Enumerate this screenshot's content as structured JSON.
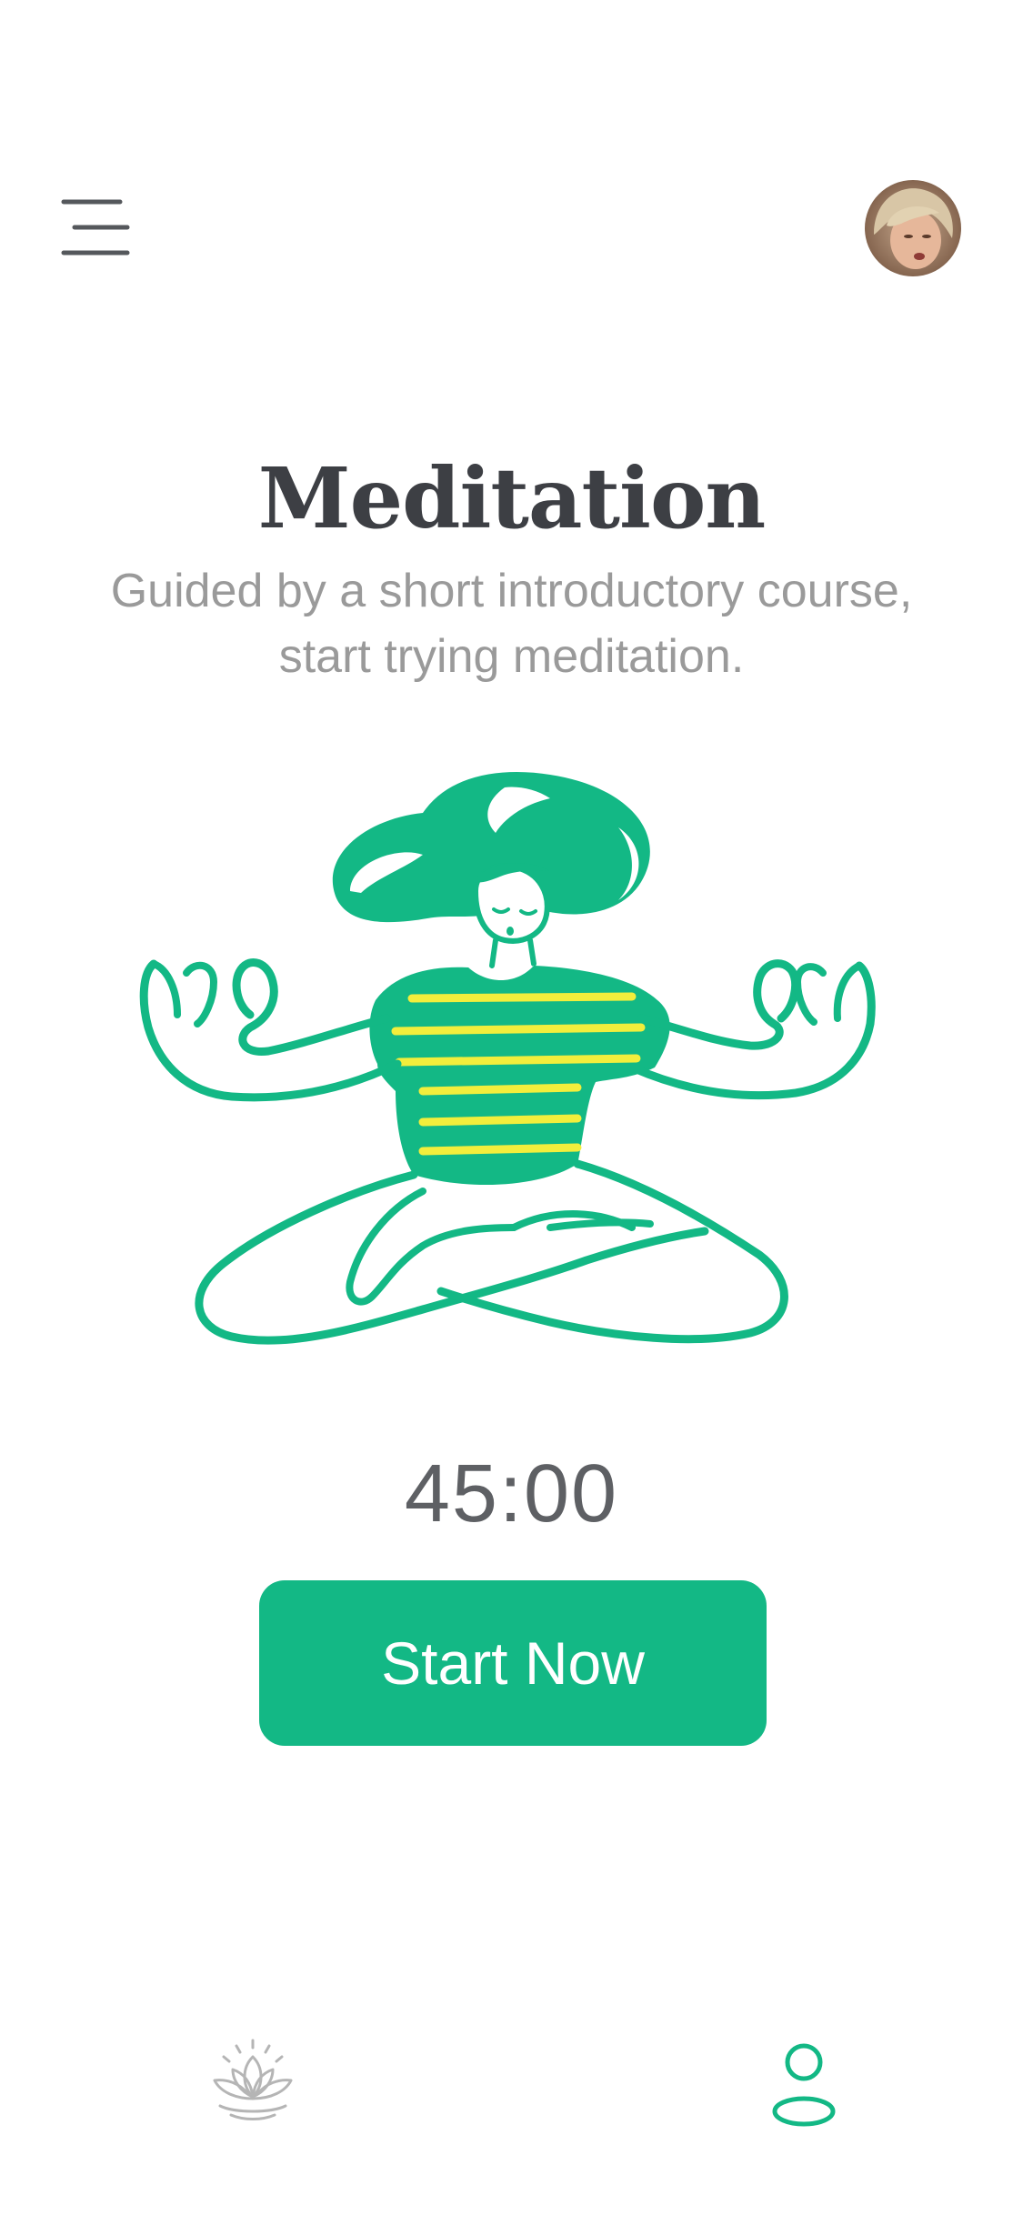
{
  "header": {
    "menu_icon": "hamburger-menu-icon",
    "avatar_icon": "user-avatar"
  },
  "main": {
    "title": "Meditation",
    "subtitle": "Guided by a short introductory course, start trying meditation.",
    "illustration": "meditating-person-illustration",
    "timer": "45:00",
    "start_label": "Start Now"
  },
  "bottom_nav": {
    "items": [
      {
        "icon": "lotus-icon",
        "active": false
      },
      {
        "icon": "profile-icon",
        "active": true
      }
    ]
  },
  "colors": {
    "accent": "#13b885",
    "stripe": "#f2ee3c",
    "title": "#3d3f44",
    "subtitle": "#9a9a9a",
    "timer": "#5e6064",
    "inactive_icon": "#b5b5b5"
  }
}
